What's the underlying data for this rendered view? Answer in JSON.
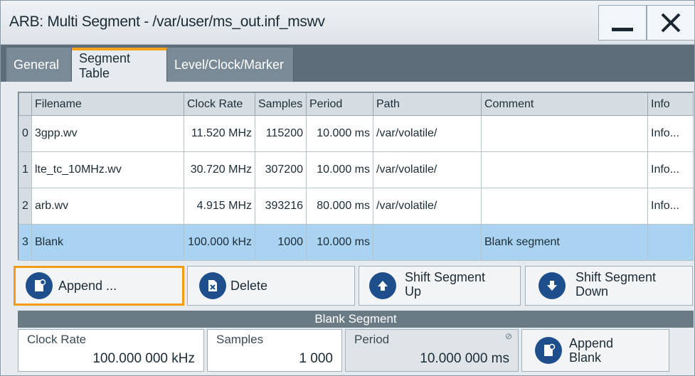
{
  "window": {
    "title": "ARB: Multi Segment - /var/user/ms_out.inf_mswv"
  },
  "tabs": [
    {
      "label": "General"
    },
    {
      "label": "Segment Table"
    },
    {
      "label": "Level/Clock/Marker"
    }
  ],
  "table": {
    "headers": [
      "Filename",
      "Clock Rate",
      "Samples",
      "Period",
      "Path",
      "Comment",
      "Info"
    ],
    "rows": [
      {
        "index": "0",
        "filename": "3gpp.wv",
        "clock_rate": "11.520 MHz",
        "samples": "115200",
        "period": "10.000  ms",
        "path": "/var/volatile/",
        "comment": "",
        "info": "Info..."
      },
      {
        "index": "1",
        "filename": "lte_tc_10MHz.wv",
        "clock_rate": "30.720 MHz",
        "samples": "307200",
        "period": "10.000  ms",
        "path": "/var/volatile/",
        "comment": "",
        "info": "Info..."
      },
      {
        "index": "2",
        "filename": "arb.wv",
        "clock_rate": "4.915 MHz",
        "samples": "393216",
        "period": "80.000  ms",
        "path": "/var/volatile/",
        "comment": "",
        "info": "Info..."
      },
      {
        "index": "3",
        "filename": "Blank",
        "clock_rate": "100.000  kHz",
        "samples": "1000",
        "period": "10.000  ms",
        "path": "",
        "comment": "Blank segment",
        "info": ""
      }
    ],
    "selected_row": 3
  },
  "actions": {
    "append": "Append ...",
    "delete": "Delete",
    "shift_up_1": "Shift Segment",
    "shift_up_2": "Up",
    "shift_down_1": "Shift Segment",
    "shift_down_2": "Down"
  },
  "blank_segment": {
    "section_title": "Blank Segment",
    "clock_rate_label": "Clock Rate",
    "clock_rate_value": "100.000 000 kHz",
    "samples_label": "Samples",
    "samples_value": "1 000",
    "period_label": "Period",
    "period_value": "10.000 000 ms",
    "append_blank_1": "Append",
    "append_blank_2": "Blank"
  },
  "icons": {
    "close": "close-icon",
    "minimize": "minimize-icon",
    "append": "append-file-icon",
    "delete": "delete-file-icon",
    "shift_up": "arrow-up-icon",
    "shift_down": "arrow-down-icon",
    "lock": "read-only-icon"
  },
  "colors": {
    "accent": "#f39c12",
    "selected_row": "#aad3f1",
    "icon_blue": "#1e4f8c"
  }
}
